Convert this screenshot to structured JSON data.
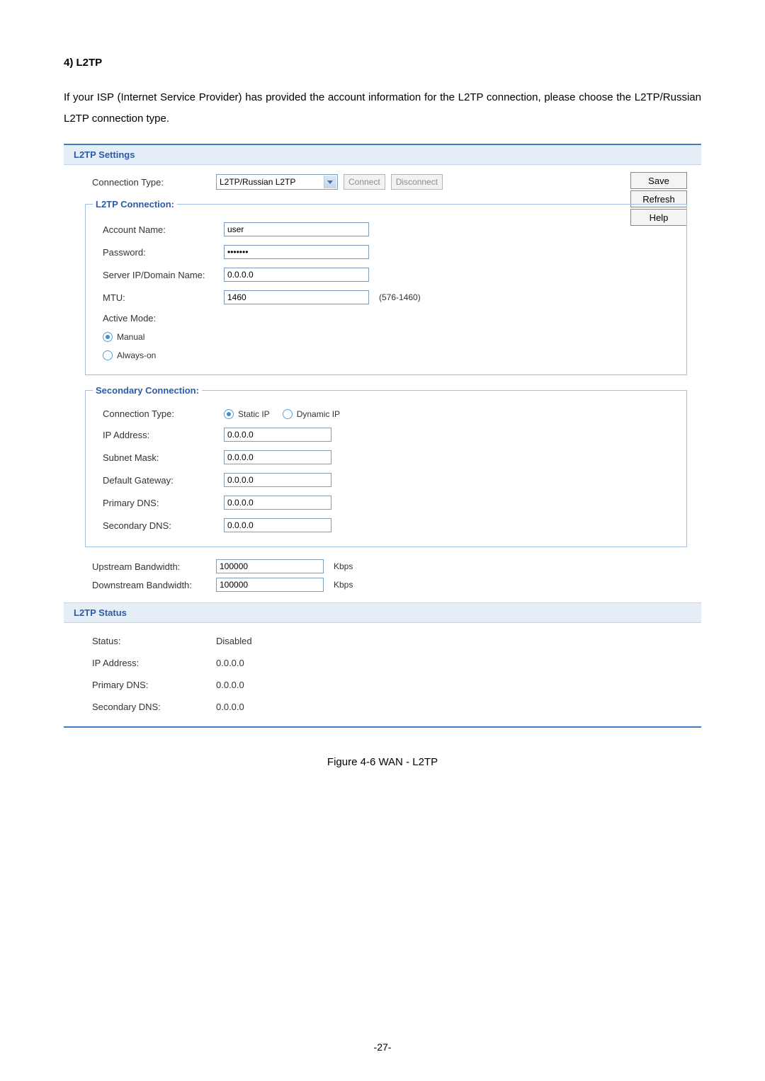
{
  "document": {
    "heading": "4)   L2TP",
    "intro": "If your ISP (Internet Service Provider) has provided the account information for the L2TP connection, please choose the L2TP/Russian L2TP connection type.",
    "caption": "Figure 4-6 WAN - L2TP",
    "page_number": "-27-"
  },
  "side_buttons": {
    "save": "Save",
    "refresh": "Refresh",
    "help": "Help"
  },
  "settings": {
    "header": "L2TP Settings",
    "connection_type_label": "Connection Type:",
    "connection_type_value": "L2TP/Russian L2TP",
    "connect_btn": "Connect",
    "disconnect_btn": "Disconnect",
    "l2tp_conn": {
      "legend": "L2TP Connection:",
      "account_label": "Account Name:",
      "account_value": "user",
      "password_label": "Password:",
      "password_value": "•••••••",
      "server_label": "Server IP/Domain Name:",
      "server_value": "0.0.0.0",
      "mtu_label": "MTU:",
      "mtu_value": "1460",
      "mtu_hint": "(576-1460)",
      "active_mode_label": "Active Mode:",
      "mode_manual": "Manual",
      "mode_always": "Always-on"
    },
    "secondary": {
      "legend": "Secondary Connection:",
      "conn_type_label": "Connection Type:",
      "static_label": "Static IP",
      "dynamic_label": "Dynamic IP",
      "ip_label": "IP Address:",
      "ip_value": "0.0.0.0",
      "mask_label": "Subnet Mask:",
      "mask_value": "0.0.0.0",
      "gw_label": "Default Gateway:",
      "gw_value": "0.0.0.0",
      "pdns_label": "Primary DNS:",
      "pdns_value": "0.0.0.0",
      "sdns_label": "Secondary DNS:",
      "sdns_value": "0.0.0.0"
    },
    "up_label": "Upstream Bandwidth:",
    "up_value": "100000",
    "down_label": "Downstream Bandwidth:",
    "down_value": "100000",
    "kbps": "Kbps"
  },
  "status": {
    "header": "L2TP Status",
    "status_label": "Status:",
    "status_value": "Disabled",
    "ip_label": "IP Address:",
    "ip_value": "0.0.0.0",
    "pdns_label": "Primary DNS:",
    "pdns_value": "0.0.0.0",
    "sdns_label": "Secondary DNS:",
    "sdns_value": "0.0.0.0"
  }
}
